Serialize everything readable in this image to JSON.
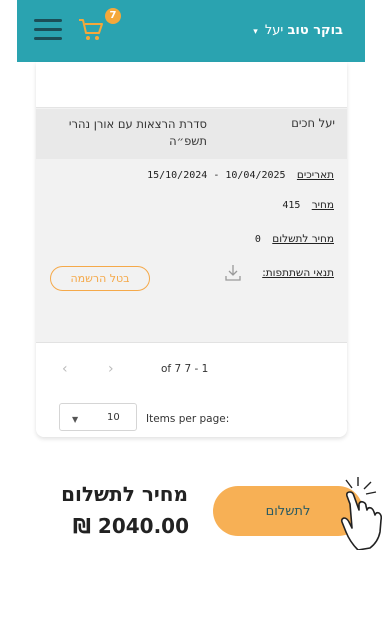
{
  "header": {
    "greeting": "בוקר טוב",
    "user_name": "יעל",
    "chevron": "▾",
    "cart_count": "7",
    "menu_icon": "hamburger-icon",
    "cart_icon": "cart-icon"
  },
  "row": {
    "student_name": "יעל חכים",
    "course_name": "סדרת הרצאות עם אורן נהרי תשפ״ה"
  },
  "details": {
    "dates_label": "תאריכים",
    "dates_value": "10/04/2025 - 15/10/2024",
    "price_label": "מחיר",
    "price_value": "415",
    "to_pay_label": "מחיר לתשלום",
    "to_pay_value": "0",
    "terms_label": "תנאי השתתפות:",
    "cancel_label": "בטל הרשמה"
  },
  "pagination": {
    "range_text": "of 7 7 - 1",
    "items_per_page_label": "Items per page:",
    "items_per_page_value": "10"
  },
  "footer": {
    "price_label": "מחיר לתשלום",
    "price_amount": "2040.00 ₪",
    "pay_label": "לתשלום"
  },
  "colors": {
    "header_bg": "#2aa3b0",
    "accent": "#f7b055"
  }
}
